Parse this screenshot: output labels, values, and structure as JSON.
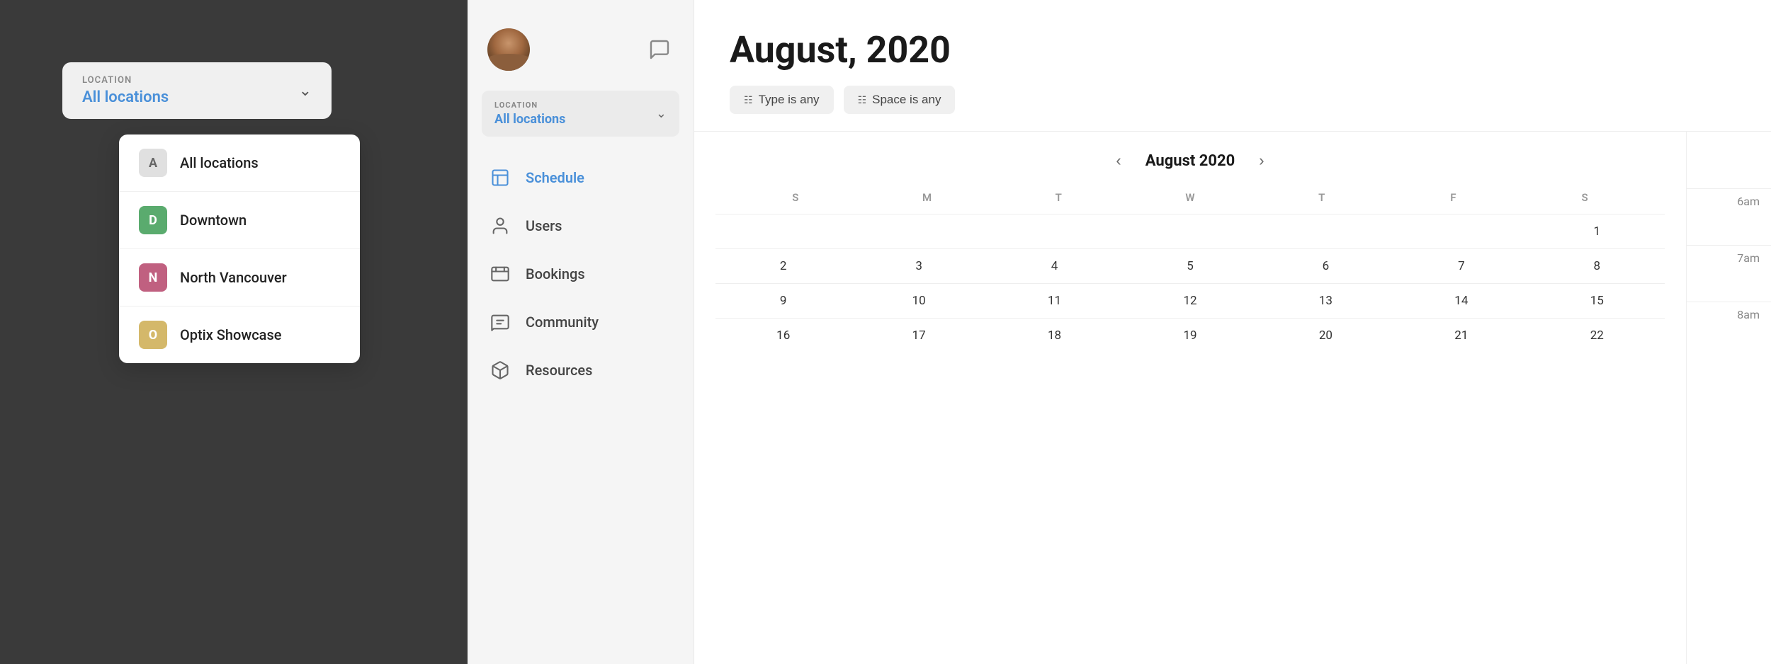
{
  "left": {
    "location_label": "LOCATION",
    "location_value": "All locations",
    "chevron": "∨",
    "dropdown": {
      "items": [
        {
          "id": "all",
          "letter": "A",
          "label": "All locations",
          "color_class": "icon-all"
        },
        {
          "id": "downtown",
          "letter": "D",
          "label": "Downtown",
          "color_class": "icon-downtown"
        },
        {
          "id": "north",
          "letter": "N",
          "label": "North Vancouver",
          "color_class": "icon-north"
        },
        {
          "id": "optix",
          "letter": "O",
          "label": "Optix Showcase",
          "color_class": "icon-optix"
        }
      ]
    }
  },
  "sidebar": {
    "location_label": "LOCATION",
    "location_value": "All locations",
    "chevron": "∨",
    "nav_items": [
      {
        "id": "schedule",
        "label": "Schedule",
        "active": true
      },
      {
        "id": "users",
        "label": "Users",
        "active": false
      },
      {
        "id": "bookings",
        "label": "Bookings",
        "active": false
      },
      {
        "id": "community",
        "label": "Community",
        "active": false
      },
      {
        "id": "resources",
        "label": "Resources",
        "active": false
      }
    ]
  },
  "main": {
    "page_title": "August, 2020",
    "filters": {
      "type_label": "Type is any",
      "space_label": "Space is any"
    },
    "calendar": {
      "month_title": "August 2020",
      "day_headers": [
        "S",
        "M",
        "T",
        "W",
        "T",
        "F",
        "S"
      ],
      "weeks": [
        [
          "",
          "",
          "",
          "",
          "",
          "",
          "1"
        ],
        [
          "2",
          "3",
          "4",
          "5",
          "6",
          "7",
          "8"
        ],
        [
          "9",
          "10",
          "11",
          "12",
          "13",
          "14",
          "15"
        ],
        [
          "16",
          "17",
          "18",
          "19",
          "20",
          "21",
          "22"
        ]
      ]
    },
    "time_slots": [
      "6am",
      "7am",
      "8am"
    ]
  }
}
